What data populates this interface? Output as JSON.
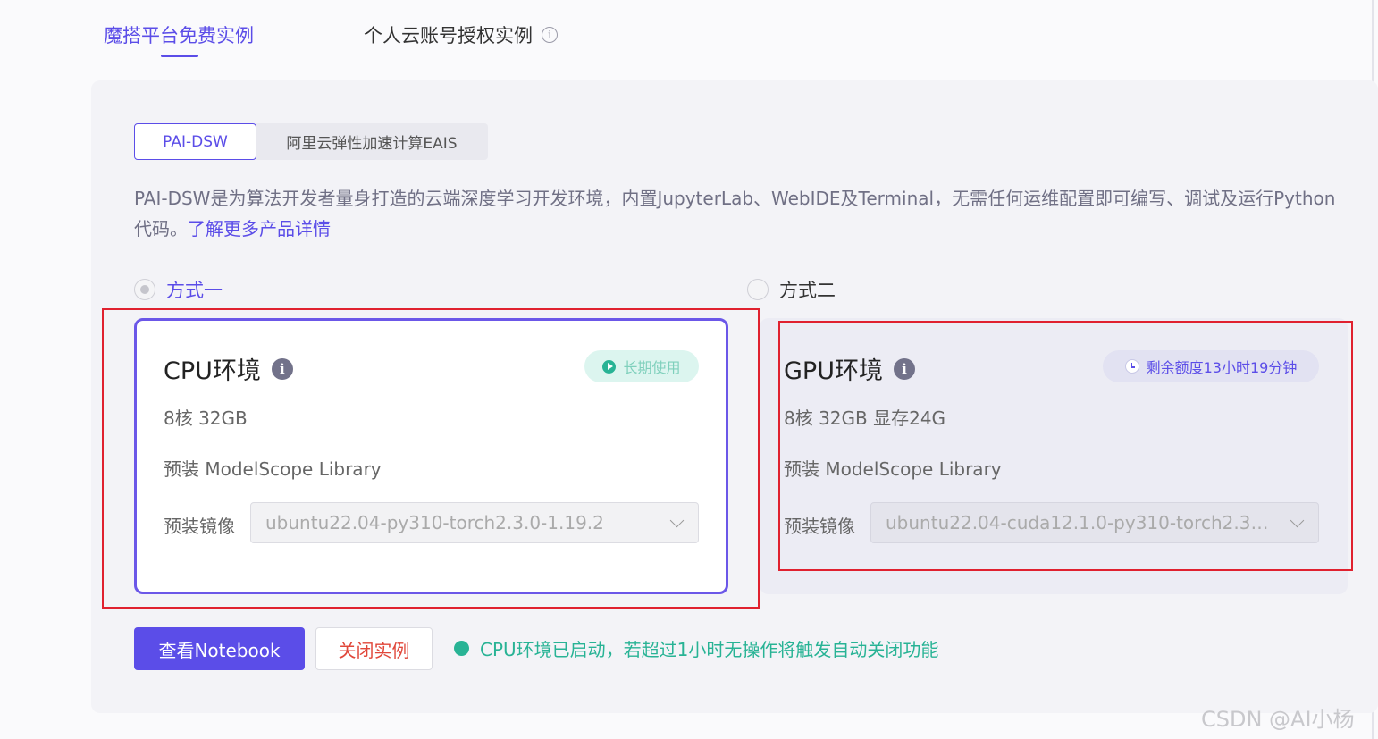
{
  "top_tabs": {
    "free": "魔搭平台免费实例",
    "personal": "个人云账号授权实例"
  },
  "segments": {
    "pai": "PAI-DSW",
    "eais": "阿里云弹性加速计算EAIS"
  },
  "description": {
    "text": "PAI-DSW是为算法开发者量身打造的云端深度学习开发环境，内置JupyterLab、WebIDE及Terminal，无需任何运维配置即可编写、调试及运行Python代码。",
    "link": "了解更多产品详情"
  },
  "options": {
    "one": "方式一",
    "two": "方式二"
  },
  "cpu_card": {
    "title": "CPU环境",
    "badge": "长期使用",
    "spec": "8核 32GB",
    "library": "预装 ModelScope Library",
    "image_label": "预装镜像",
    "image_value": "ubuntu22.04-py310-torch2.3.0-1.19.2"
  },
  "gpu_card": {
    "title": "GPU环境",
    "badge": "剩余额度13小时19分钟",
    "spec": "8核 32GB 显存24G",
    "library": "预装 ModelScope Library",
    "image_label": "预装镜像",
    "image_value": "ubuntu22.04-cuda12.1.0-py310-torch2.3...."
  },
  "actions": {
    "view_notebook": "查看Notebook",
    "close_instance": "关闭实例",
    "status": "CPU环境已启动，若超过1小时无操作将触发自动关闭功能"
  },
  "watermark": "CSDN @AI小杨",
  "colors": {
    "accent": "#5b4de8",
    "success": "#28b395",
    "danger": "#e0473a",
    "annotation_red": "#e0212f"
  },
  "icons": {
    "info": "info-icon",
    "play": "play-icon",
    "clock": "clock-icon",
    "chevron": "chevron-down-icon"
  }
}
